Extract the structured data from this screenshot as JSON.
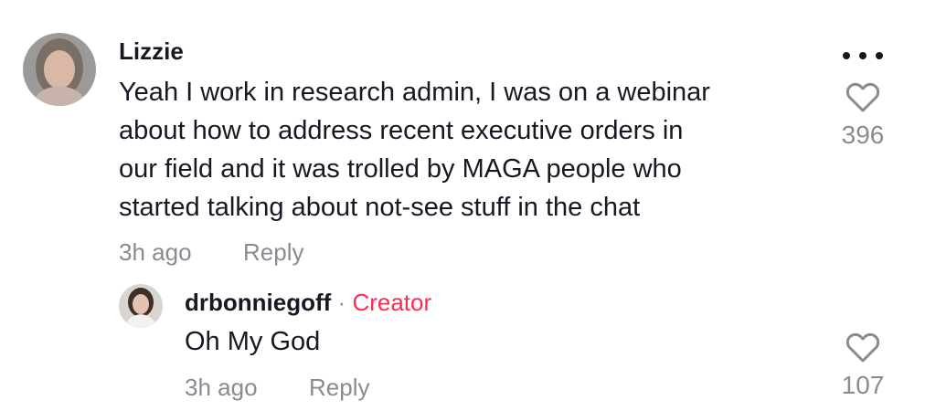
{
  "comment": {
    "username": "Lizzie",
    "text_lines": [
      "Yeah I work in research admin, I was on a webinar",
      "about how to address recent executive orders in",
      "our field and it was trolled by MAGA people who",
      "started talking about not-see stuff in the chat"
    ],
    "timestamp": "3h ago",
    "reply_label": "Reply",
    "like_count": "396",
    "more_icon": "more-horizontal-icon",
    "like_icon": "heart-outline-icon"
  },
  "reply": {
    "username": "drbonniegoff",
    "separator": "·",
    "badge": "Creator",
    "text": "Oh My God",
    "timestamp": "3h ago",
    "reply_label": "Reply",
    "like_count": "107",
    "like_icon": "heart-outline-icon"
  },
  "colors": {
    "primary_text": "#161823",
    "secondary_text": "#8a8b91",
    "creator_accent": "#fe2c55"
  }
}
